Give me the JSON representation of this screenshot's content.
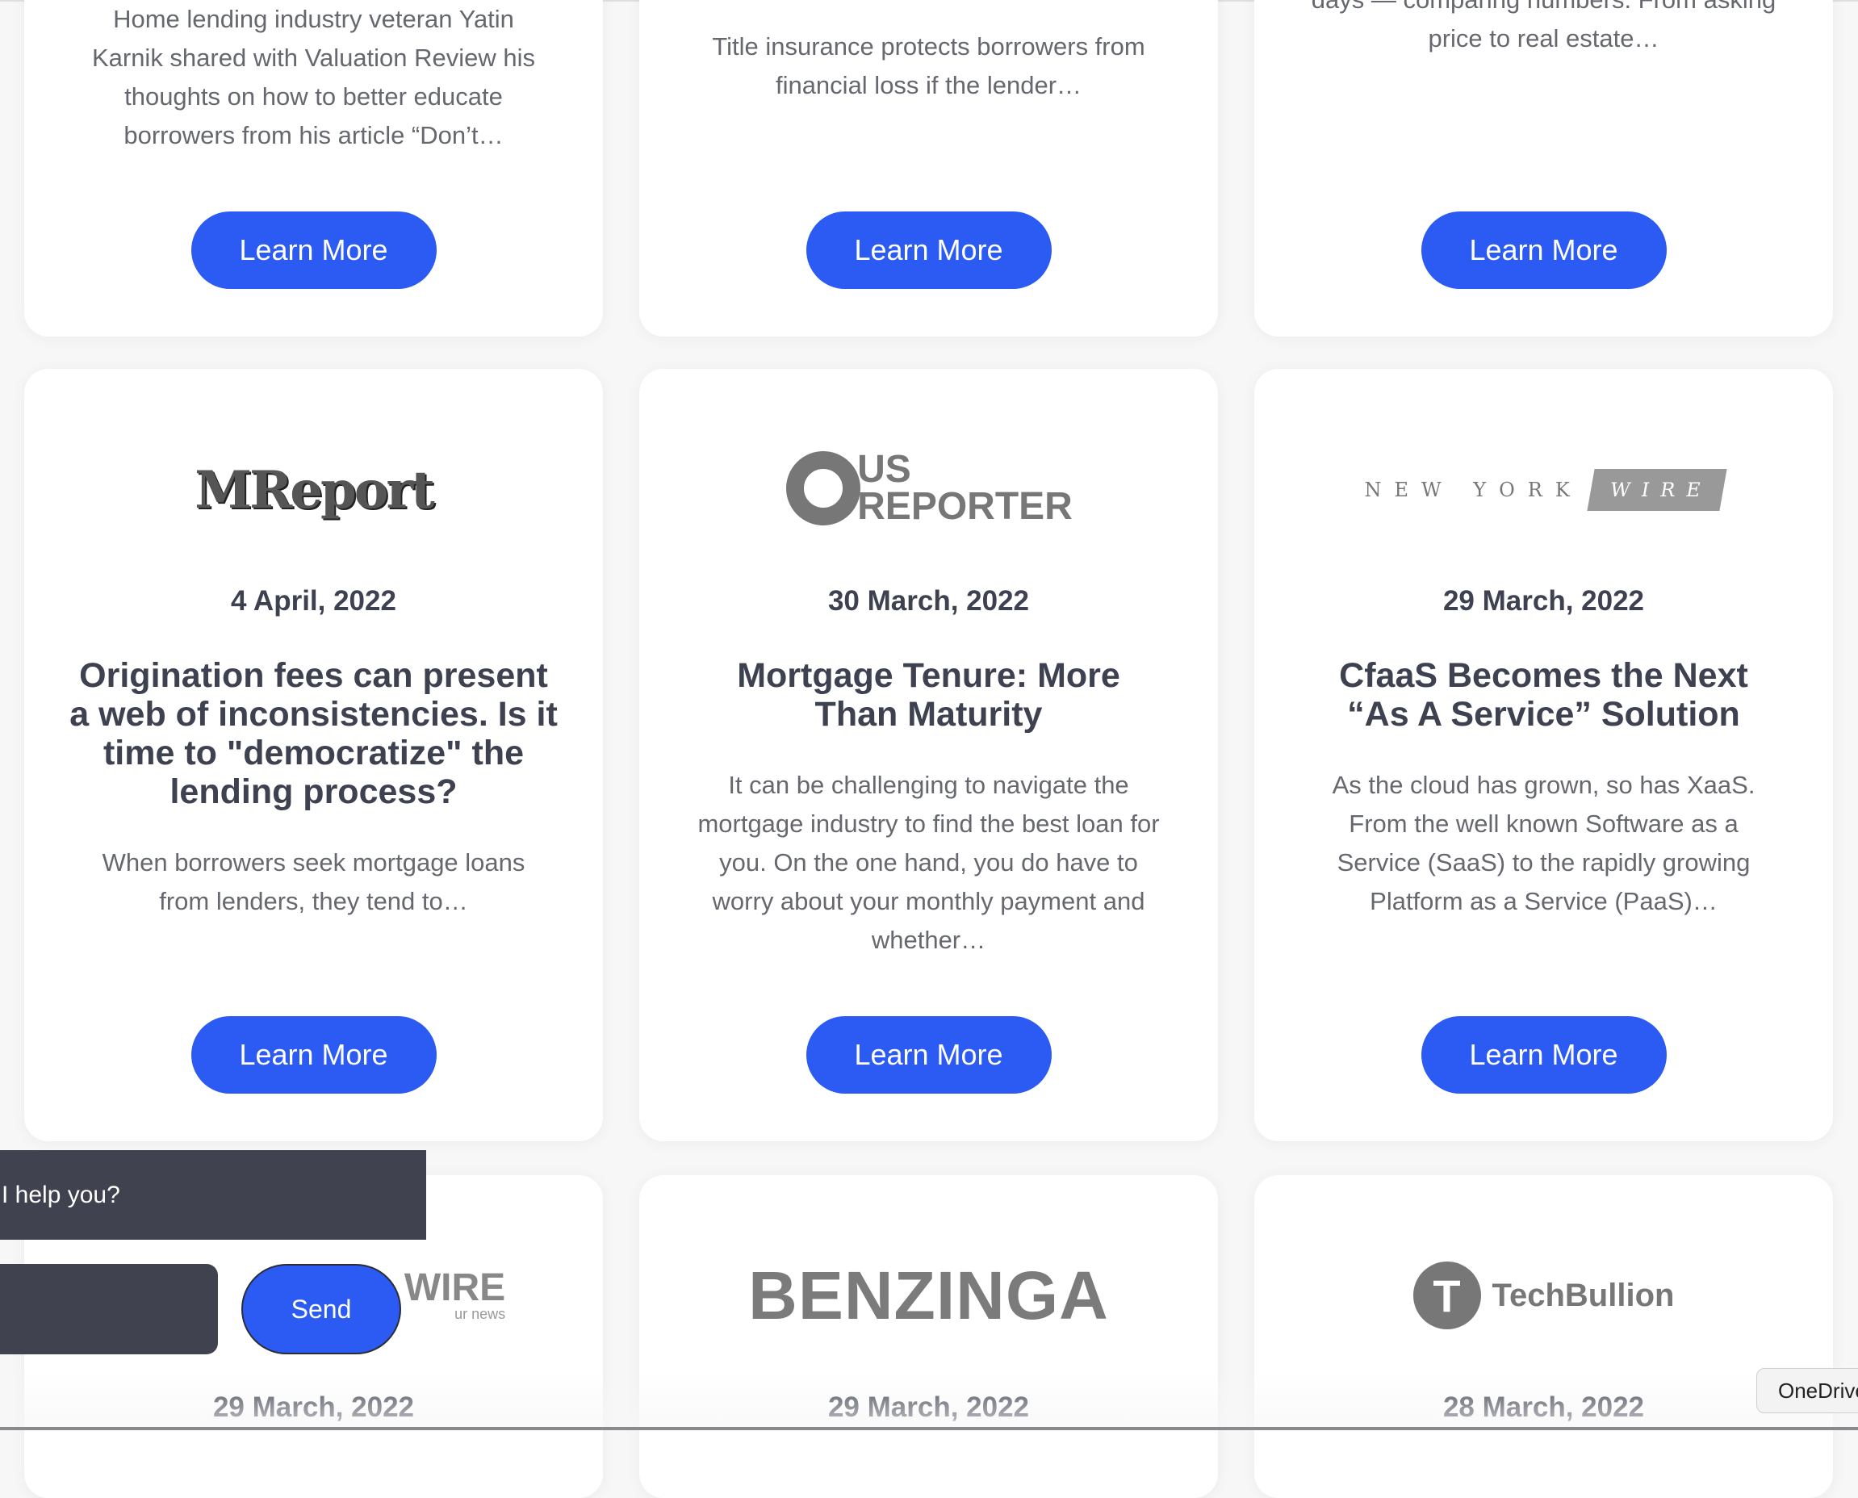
{
  "row1": [
    {
      "excerpt_lines": [
        "Home lending industry veteran Yatin",
        "Karnik shared with Valuation Review his",
        "thoughts on how to better educate",
        "borrowers from his article “Don’t…"
      ],
      "button": "Learn More"
    },
    {
      "excerpt_lines": [
        "Title insurance protects borrowers from",
        "financial loss if the lender…"
      ],
      "button": "Learn More"
    },
    {
      "excerpt_lines": [
        "days — comparing numbers. From asking",
        "price to real estate…"
      ],
      "button": "Learn More"
    }
  ],
  "row2": [
    {
      "logo": "MReport",
      "logo_icon": "mreport-logo",
      "date": "4 April, 2022",
      "title": "Origination fees can present a web of inconsistencies. Is it time to \"democratize\" the lending process?",
      "excerpt_lines": [
        "When borrowers seek mortgage loans",
        "from lenders, they tend to…"
      ],
      "button": "Learn More"
    },
    {
      "logo_top": "US",
      "logo_bottom": "REPORTER",
      "logo_icon": "us-reporter-logo",
      "date": "30 March, 2022",
      "title": "Mortgage Tenure: More Than Maturity",
      "excerpt_lines": [
        "It can be challenging to navigate the",
        "mortgage industry to find the best loan for",
        "you. On the one hand, you do have to",
        "worry about your monthly payment and",
        "whether…"
      ],
      "button": "Learn More"
    },
    {
      "logo_left": "NEW YORK",
      "logo_right": "WIRE",
      "logo_icon": "new-york-wire-logo",
      "date": "29 March, 2022",
      "title": "CfaaS Becomes the Next “As A Service” Solution",
      "excerpt_lines": [
        "As the cloud has grown, so has XaaS.",
        "From the well known Software as a",
        "Service (SaaS) to the rapidly growing",
        "Platform as a Service (PaaS)…"
      ],
      "button": "Learn More"
    }
  ],
  "row3": [
    {
      "logo_visible": "WIRE",
      "logo_tagline": "ur news",
      "logo_icon": "globe-wire-logo",
      "date": "29 March, 2022"
    },
    {
      "logo": "BENZINGA",
      "logo_icon": "benzinga-logo",
      "date": "29 March, 2022"
    },
    {
      "logo": "TechBullion",
      "logo_mark": "T",
      "logo_icon": "techbullion-logo",
      "date": "28 March, 2022"
    }
  ],
  "chat": {
    "question": "I help you?",
    "send_label": "Send"
  },
  "onedrive": {
    "label": "OneDrive"
  },
  "colors": {
    "accent": "#2b5bf3",
    "text": "#3e4150",
    "muted": "#66686f",
    "chat_bg": "#40434f"
  }
}
